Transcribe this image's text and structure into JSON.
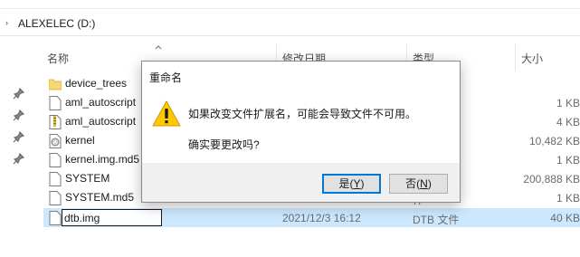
{
  "address": {
    "path": "ALEXELEC (D:)"
  },
  "columns": {
    "name": "名称",
    "date": "修改日期",
    "type": "类型",
    "size": "大小"
  },
  "files": [
    {
      "name": "device_trees",
      "icon": "folder-icon",
      "date": "",
      "type": "",
      "size": ""
    },
    {
      "name": "aml_autoscript",
      "icon": "file-icon",
      "date": "",
      "type": "",
      "size": "1 KB"
    },
    {
      "name": "aml_autoscript",
      "icon": "zip-file-icon",
      "date": "",
      "type": "ed)文件",
      "size": "4 KB"
    },
    {
      "name": "kernel",
      "icon": "disc-image-icon",
      "date": "",
      "type": "文件",
      "size": "10,482 KB"
    },
    {
      "name": "kernel.img.md5",
      "icon": "file-icon",
      "date": "",
      "type": "件",
      "size": "1 KB"
    },
    {
      "name": "SYSTEM",
      "icon": "file-icon",
      "date": "",
      "type": "",
      "size": "200,888 KB"
    },
    {
      "name": "SYSTEM.md5",
      "icon": "file-icon",
      "date": "",
      "type": "件",
      "size": "1 KB"
    },
    {
      "name": "dtb.img",
      "icon": "file-icon",
      "date": "2021/12/3 16:12",
      "type": "DTB 文件",
      "size": "40 KB",
      "selected": true,
      "renaming": true
    }
  ],
  "dialog": {
    "title": "重命名",
    "message": "如果改变文件扩展名，可能会导致文件不可用。",
    "question": "确实要更改吗?",
    "yes_text": "是(",
    "yes_key": "Y",
    "yes_close": ")",
    "no_text": "否(",
    "no_key": "N",
    "no_close": ")"
  },
  "colors": {
    "selection": "#cce8ff",
    "accent": "#0078d7",
    "folder": "#f8d775",
    "warning": "#ffc800"
  }
}
